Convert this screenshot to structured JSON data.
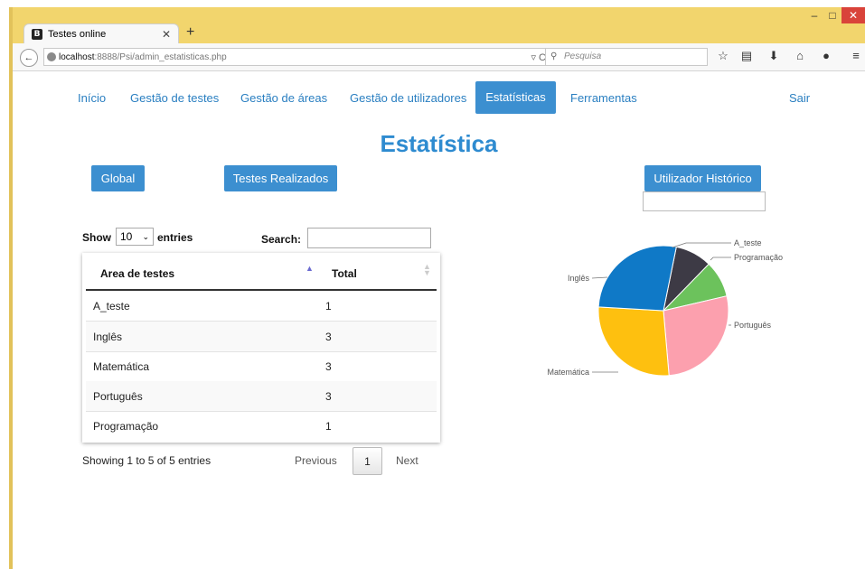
{
  "browser": {
    "tab_title": "Testes online",
    "tab_icon_letter": "B",
    "url_host": "localhost",
    "url_path": ":8888/Psi/admin_estatisticas.php",
    "search_placeholder": "Pesquisa"
  },
  "menu": {
    "items": [
      "Início",
      "Gestão de testes",
      "Gestão de áreas",
      "Gestão de utilizadores",
      "Estatísticas",
      "Ferramentas",
      "Sair"
    ],
    "active": "Estatísticas"
  },
  "page_title": "Estatística",
  "buttons": {
    "global": "Global",
    "testes": "Testes Realizados",
    "historico": "Utilizador Histórico"
  },
  "table": {
    "show_label": "Show",
    "length_value": "10",
    "entries_label": "entries",
    "search_label": "Search:",
    "columns": [
      "Area de testes",
      "Total"
    ],
    "rows": [
      {
        "area": "A_teste",
        "total": "1"
      },
      {
        "area": "Inglês",
        "total": "3"
      },
      {
        "area": "Matemática",
        "total": "3"
      },
      {
        "area": "Português",
        "total": "3"
      },
      {
        "area": "Programação",
        "total": "1"
      }
    ],
    "info": "Showing 1 to 5 of 5 entries",
    "prev": "Previous",
    "current_page": "1",
    "next": "Next"
  },
  "chart_data": {
    "type": "pie",
    "labels": [
      "A_teste",
      "Programação",
      "Português",
      "Matemática",
      "Inglês"
    ],
    "values": [
      1,
      1,
      3,
      3,
      3
    ],
    "colors": [
      "#3d3a45",
      "#6cc25c",
      "#fca0ae",
      "#fec00f",
      "#0f79c7"
    ]
  }
}
